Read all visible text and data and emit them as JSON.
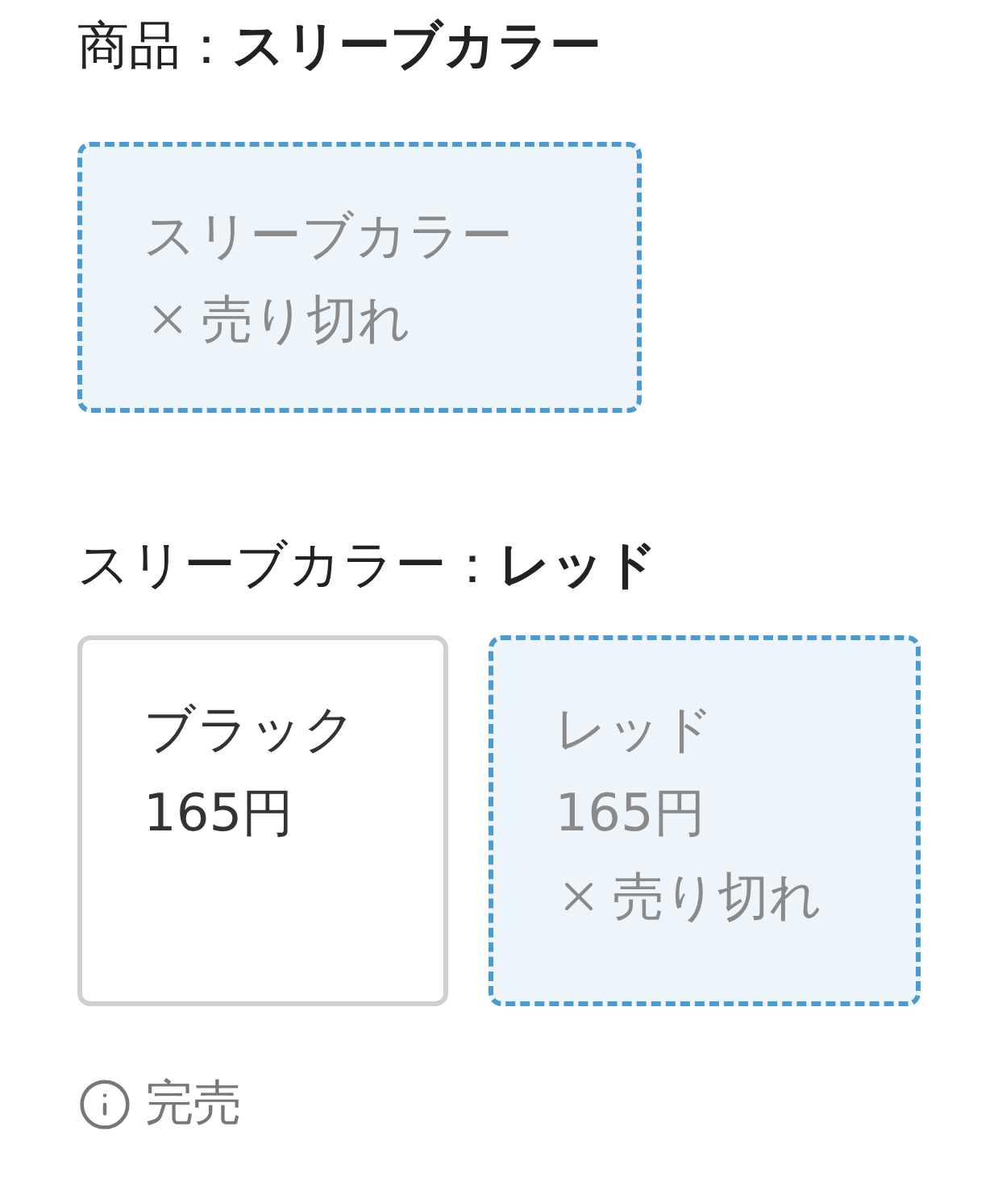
{
  "product": {
    "label": "商品：",
    "value": "スリーブカラー"
  },
  "product_options": [
    {
      "name": "スリーブカラー",
      "sold_out": true,
      "sold_out_text": "売り切れ"
    }
  ],
  "color": {
    "label": "スリーブカラー：",
    "value": "レッド"
  },
  "color_options": [
    {
      "name": "ブラック",
      "price": "165円",
      "sold_out": false
    },
    {
      "name": "レッド",
      "price": "165円",
      "sold_out": true,
      "sold_out_text": "売り切れ"
    }
  ],
  "notice": "完売"
}
